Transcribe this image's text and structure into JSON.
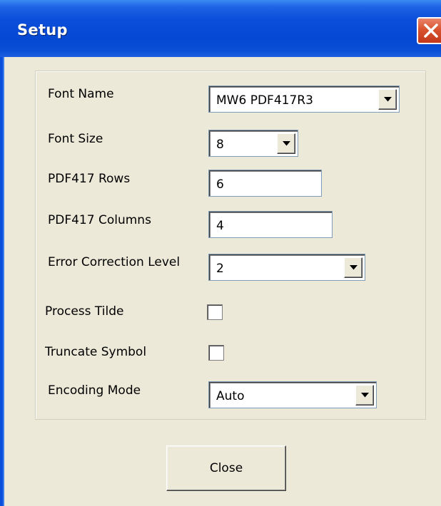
{
  "window": {
    "title": "Setup"
  },
  "fields": {
    "font_name": {
      "label": "Font Name",
      "value": "MW6 PDF417R3"
    },
    "font_size": {
      "label": "Font Size",
      "value": "8"
    },
    "pdf417_rows": {
      "label": "PDF417 Rows",
      "value": "6"
    },
    "pdf417_columns": {
      "label": "PDF417 Columns",
      "value": "4"
    },
    "error_correction": {
      "label": "Error Correction Level",
      "value": "2"
    },
    "process_tilde": {
      "label": "Process Tilde",
      "checked": false
    },
    "truncate_symbol": {
      "label": "Truncate Symbol",
      "checked": false
    },
    "encoding_mode": {
      "label": "Encoding Mode",
      "value": "Auto"
    }
  },
  "buttons": {
    "close_label": "Close"
  },
  "icons": {
    "close": "close-icon",
    "dropdown": "chevron-down-icon"
  },
  "colors": {
    "titlebar": "#0a4ed9",
    "close_button": "#d9532f",
    "dialog_bg": "#ece9d8"
  }
}
